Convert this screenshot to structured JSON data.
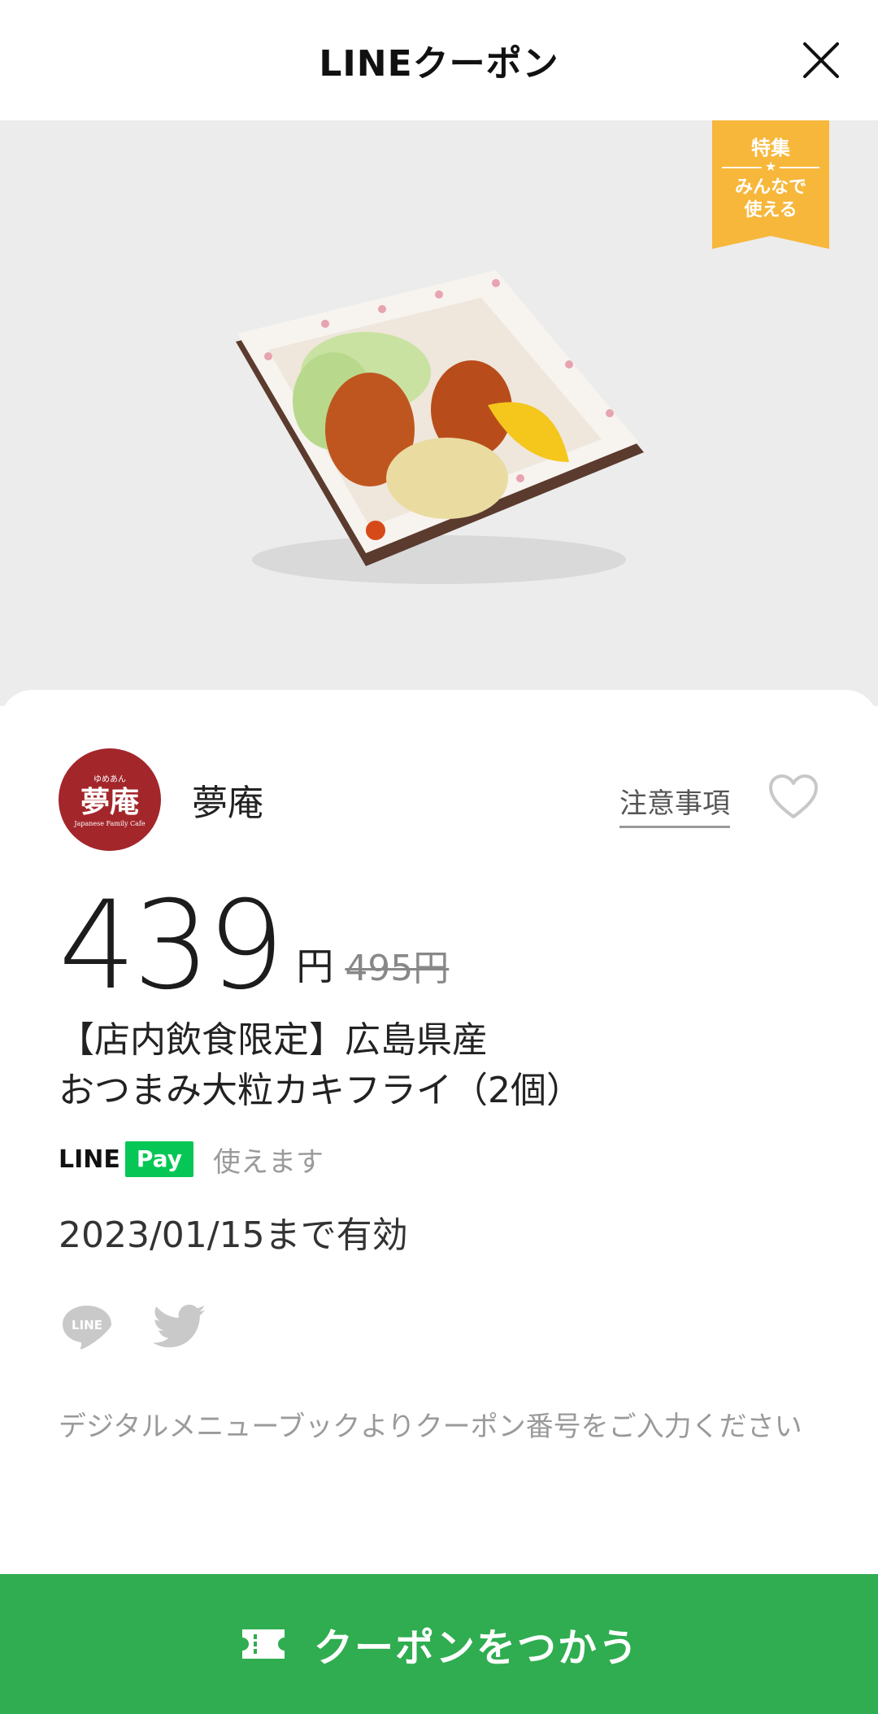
{
  "header": {
    "brand": "LINEクーポン",
    "close_icon": "close-icon"
  },
  "hero": {
    "image": "fried-oyster-dish-photo",
    "badge": {
      "title": "特集",
      "star": "★",
      "subtitle": "みんなで\n使える",
      "color": "#f7b73b"
    }
  },
  "shop": {
    "logo_text": "夢庵",
    "logo_ruby": "ゆめあん",
    "logo_sub": "Japanese Family Cafe",
    "name": "夢庵",
    "logo_color": "#a3262b",
    "notice_label": "注意事項",
    "favorite_icon": "heart-outline-icon"
  },
  "price": {
    "amount": "439",
    "unit": "円",
    "original": "495円"
  },
  "coupon": {
    "title": "【店内飲食限定】広島県産\nおつまみ大粒カキフライ（2個）",
    "pay": {
      "line_label": "LINE",
      "pay_label": "Pay",
      "status": "使えます",
      "color": "#06c755"
    },
    "validity": "2023/01/15まで有効",
    "instruction": "デジタルメニューブックよりクーポン番号をご入力ください"
  },
  "share": {
    "line_label": "LINE",
    "line_icon": "line-share-icon",
    "twitter_icon": "twitter-icon"
  },
  "cta": {
    "label": "クーポンをつかう",
    "icon": "ticket-icon",
    "color": "#2fad50"
  }
}
